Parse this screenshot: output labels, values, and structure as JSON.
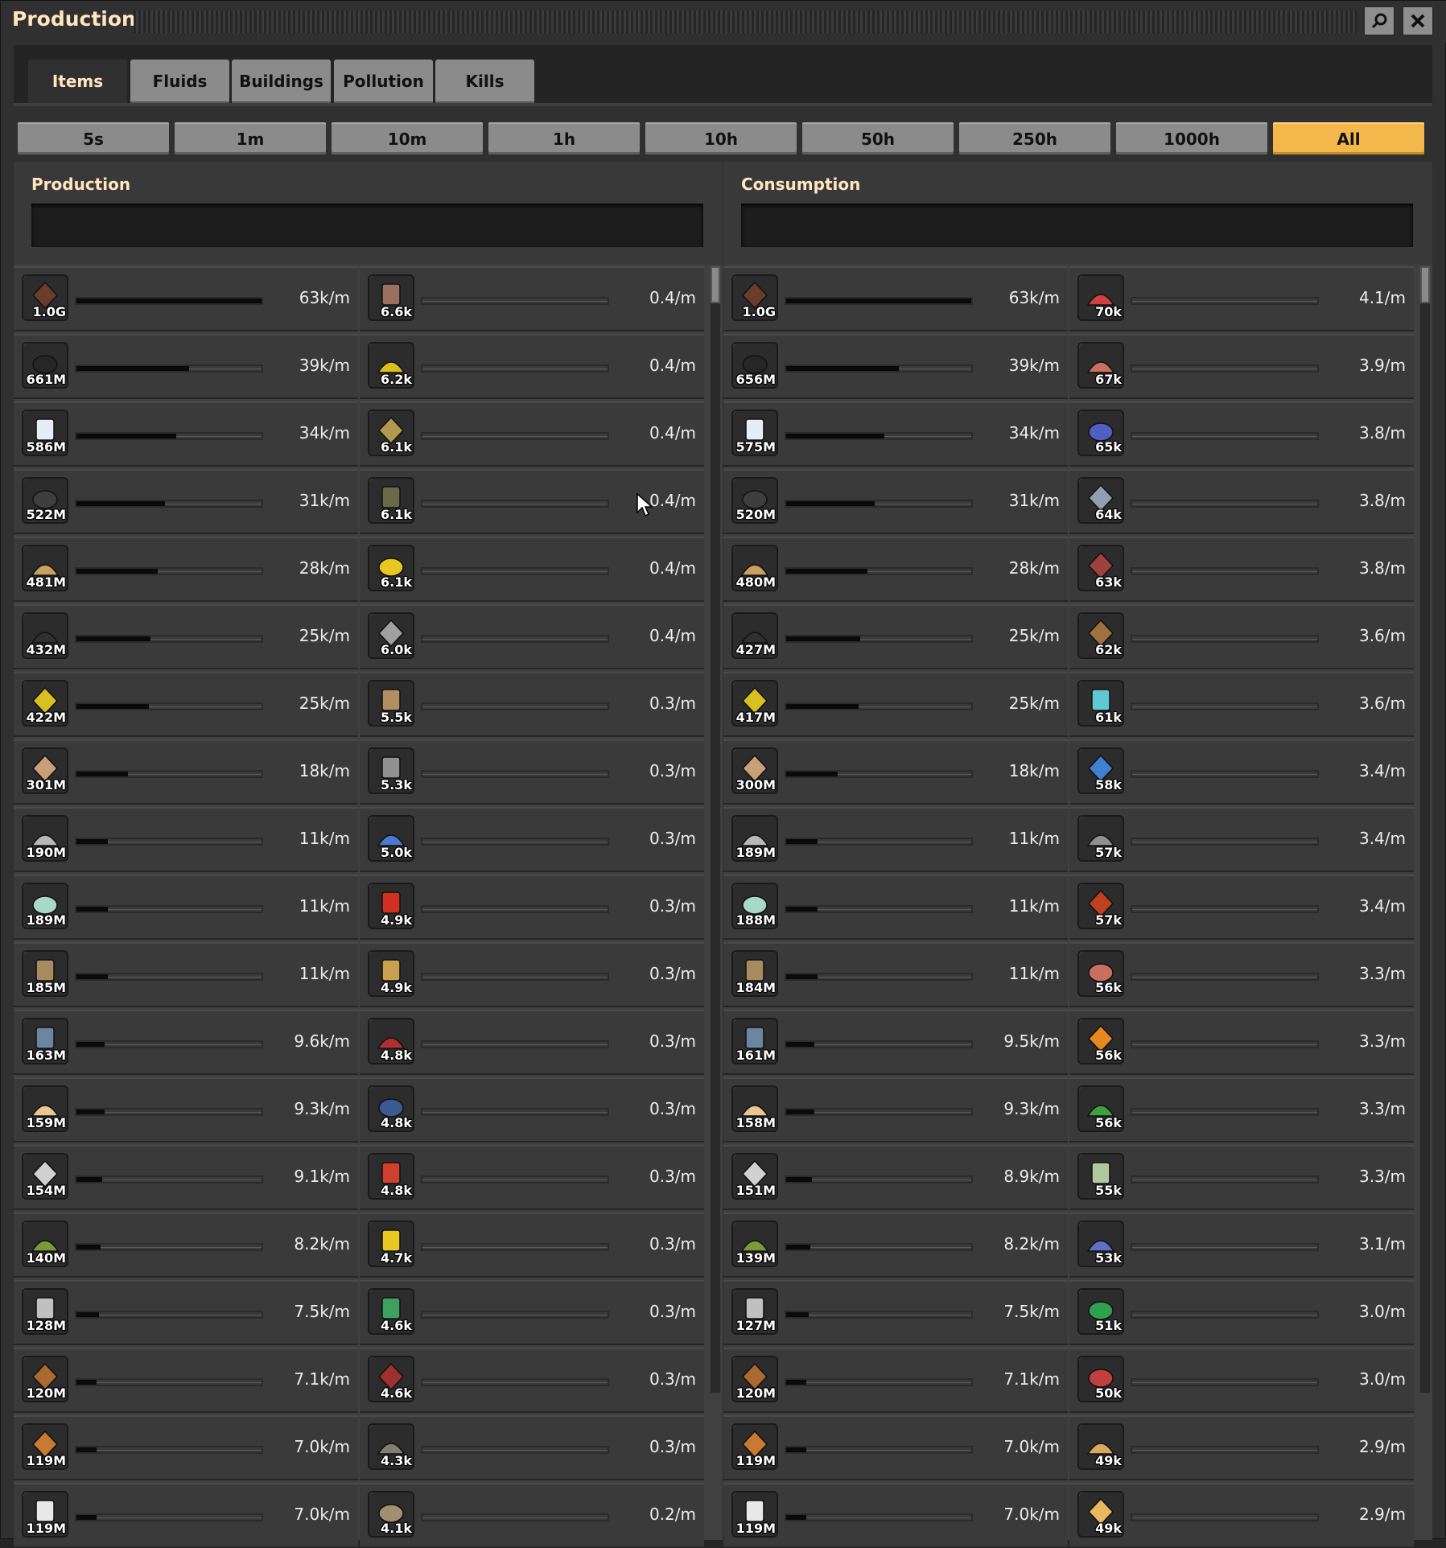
{
  "window": {
    "title": "Production",
    "search_icon": "search-icon",
    "close_icon": "close-icon"
  },
  "tabs": [
    "Items",
    "Fluids",
    "Buildings",
    "Pollution",
    "Kills"
  ],
  "active_tab": "Items",
  "time_ranges": [
    "5s",
    "1m",
    "10m",
    "1h",
    "10h",
    "50h",
    "250h",
    "1000h",
    "All"
  ],
  "active_time_range": "All",
  "production": {
    "title": "Production",
    "columns": [
      [
        {
          "icon": "stone-brick-icon",
          "count": "1.0G",
          "rate": "63k/m",
          "level": 1.0,
          "color": "#6b3b2b"
        },
        {
          "icon": "coal-icon",
          "count": "661M",
          "rate": "39k/m",
          "level": 0.61,
          "color": "#262626"
        },
        {
          "icon": "water-barrel-icon",
          "count": "586M",
          "rate": "34k/m",
          "level": 0.54,
          "color": "#e6eef5"
        },
        {
          "icon": "iron-ore-icon",
          "count": "522M",
          "rate": "31k/m",
          "level": 0.48,
          "color": "#3e3e3e"
        },
        {
          "icon": "sand-icon",
          "count": "481M",
          "rate": "28k/m",
          "level": 0.44,
          "color": "#c9a060"
        },
        {
          "icon": "coal-ore-icon",
          "count": "432M",
          "rate": "25k/m",
          "level": 0.4,
          "color": "#2f2f2f"
        },
        {
          "icon": "sulfur-icon",
          "count": "422M",
          "rate": "25k/m",
          "level": 0.39,
          "color": "#d8c020"
        },
        {
          "icon": "gravel-icon",
          "count": "301M",
          "rate": "18k/m",
          "level": 0.28,
          "color": "#c8a078"
        },
        {
          "icon": "plate-icon",
          "count": "190M",
          "rate": "11k/m",
          "level": 0.17,
          "color": "#b8b8b8"
        },
        {
          "icon": "quartz-icon",
          "count": "189M",
          "rate": "11k/m",
          "level": 0.17,
          "color": "#a8d8c8"
        },
        {
          "icon": "copper-ore-icon",
          "count": "185M",
          "rate": "11k/m",
          "level": 0.17,
          "color": "#a88a60"
        },
        {
          "icon": "cobalt-ore-icon",
          "count": "163M",
          "rate": "9.6k/m",
          "level": 0.15,
          "color": "#6c86a0"
        },
        {
          "icon": "tin-plate-icon",
          "count": "159M",
          "rate": "9.3k/m",
          "level": 0.15,
          "color": "#e8c890"
        },
        {
          "icon": "stone-icon",
          "count": "154M",
          "rate": "9.1k/m",
          "level": 0.14,
          "color": "#d0d0d0"
        },
        {
          "icon": "moss-icon",
          "count": "140M",
          "rate": "8.2k/m",
          "level": 0.13,
          "color": "#7a9a3a"
        },
        {
          "icon": "steel-plate-icon",
          "count": "128M",
          "rate": "7.5k/m",
          "level": 0.12,
          "color": "#c0c0c0"
        },
        {
          "icon": "wood-icon",
          "count": "120M",
          "rate": "7.1k/m",
          "level": 0.11,
          "color": "#a86a30"
        },
        {
          "icon": "copper-cable-icon",
          "count": "119M",
          "rate": "7.0k/m",
          "level": 0.11,
          "color": "#c87a30"
        },
        {
          "icon": "salt-icon",
          "count": "119M",
          "rate": "7.0k/m",
          "level": 0.11,
          "color": "#e8e8e8"
        }
      ],
      [
        {
          "icon": "rocket-part-icon",
          "count": "6.6k",
          "rate": "0.4/m",
          "level": 0,
          "color": "#9a7060"
        },
        {
          "icon": "uranium-cell-icon",
          "count": "6.2k",
          "rate": "0.4/m",
          "level": 0,
          "color": "#d8c020"
        },
        {
          "icon": "machine-icon",
          "count": "6.1k",
          "rate": "0.4/m",
          "level": 0,
          "color": "#b09a50"
        },
        {
          "icon": "barrel-icon",
          "count": "6.1k",
          "rate": "0.4/m",
          "level": 0,
          "color": "#6a6a4a"
        },
        {
          "icon": "radiation-icon",
          "count": "6.1k",
          "rate": "0.4/m",
          "level": 0,
          "color": "#e8c820"
        },
        {
          "icon": "ingot-icon",
          "count": "6.0k",
          "rate": "0.4/m",
          "level": 0,
          "color": "#a0a0a0"
        },
        {
          "icon": "shell-icon",
          "count": "5.5k",
          "rate": "0.3/m",
          "level": 0,
          "color": "#b09060"
        },
        {
          "icon": "blade-icon",
          "count": "5.3k",
          "rate": "0.3/m",
          "level": 0,
          "color": "#909090"
        },
        {
          "icon": "crystal-icon",
          "count": "5.0k",
          "rate": "0.3/m",
          "level": 0,
          "color": "#4a7ad0"
        },
        {
          "icon": "drops-icon",
          "count": "4.9k",
          "rate": "0.3/m",
          "level": 0,
          "color": "#d03020"
        },
        {
          "icon": "leaf-icon",
          "count": "4.9k",
          "rate": "0.3/m",
          "level": 0,
          "color": "#c8a050"
        },
        {
          "icon": "module-icon",
          "count": "4.8k",
          "rate": "0.3/m",
          "level": 0,
          "color": "#b03030"
        },
        {
          "icon": "orb-icon",
          "count": "4.8k",
          "rate": "0.3/m",
          "level": 0,
          "color": "#3a5a90"
        },
        {
          "icon": "rocket-icon",
          "count": "4.8k",
          "rate": "0.3/m",
          "level": 0,
          "color": "#d04030"
        },
        {
          "icon": "arm-icon",
          "count": "4.7k",
          "rate": "0.3/m",
          "level": 0,
          "color": "#e8c820"
        },
        {
          "icon": "tube-icon",
          "count": "4.6k",
          "rate": "0.3/m",
          "level": 0,
          "color": "#40a060"
        },
        {
          "icon": "red-gem-icon",
          "count": "4.6k",
          "rate": "0.3/m",
          "level": 0,
          "color": "#a03030"
        },
        {
          "icon": "tank-icon",
          "count": "4.3k",
          "rate": "0.3/m",
          "level": 0,
          "color": "#808070"
        },
        {
          "icon": "gear-icon",
          "count": "4.1k",
          "rate": "0.2/m",
          "level": 0,
          "color": "#a09070"
        }
      ]
    ]
  },
  "consumption": {
    "title": "Consumption",
    "columns": [
      [
        {
          "icon": "stone-brick-icon",
          "count": "1.0G",
          "rate": "63k/m",
          "level": 1.0,
          "color": "#6b3b2b"
        },
        {
          "icon": "coal-icon",
          "count": "656M",
          "rate": "39k/m",
          "level": 0.61,
          "color": "#262626"
        },
        {
          "icon": "water-barrel-icon",
          "count": "575M",
          "rate": "34k/m",
          "level": 0.53,
          "color": "#e6eef5"
        },
        {
          "icon": "iron-ore-icon",
          "count": "520M",
          "rate": "31k/m",
          "level": 0.48,
          "color": "#3e3e3e"
        },
        {
          "icon": "sand-icon",
          "count": "480M",
          "rate": "28k/m",
          "level": 0.44,
          "color": "#c9a060"
        },
        {
          "icon": "coal-ore-icon",
          "count": "427M",
          "rate": "25k/m",
          "level": 0.4,
          "color": "#2f2f2f"
        },
        {
          "icon": "sulfur-icon",
          "count": "417M",
          "rate": "25k/m",
          "level": 0.39,
          "color": "#d8c020"
        },
        {
          "icon": "gravel-icon",
          "count": "300M",
          "rate": "18k/m",
          "level": 0.28,
          "color": "#c8a078"
        },
        {
          "icon": "plate-icon",
          "count": "189M",
          "rate": "11k/m",
          "level": 0.17,
          "color": "#b8b8b8"
        },
        {
          "icon": "quartz-icon",
          "count": "188M",
          "rate": "11k/m",
          "level": 0.17,
          "color": "#a8d8c8"
        },
        {
          "icon": "copper-ore-icon",
          "count": "184M",
          "rate": "11k/m",
          "level": 0.17,
          "color": "#a88a60"
        },
        {
          "icon": "cobalt-ore-icon",
          "count": "161M",
          "rate": "9.5k/m",
          "level": 0.15,
          "color": "#6c86a0"
        },
        {
          "icon": "tin-plate-icon",
          "count": "158M",
          "rate": "9.3k/m",
          "level": 0.15,
          "color": "#e8c890"
        },
        {
          "icon": "stone-icon",
          "count": "151M",
          "rate": "8.9k/m",
          "level": 0.14,
          "color": "#d0d0d0"
        },
        {
          "icon": "moss-icon",
          "count": "139M",
          "rate": "8.2k/m",
          "level": 0.13,
          "color": "#7a9a3a"
        },
        {
          "icon": "steel-plate-icon",
          "count": "127M",
          "rate": "7.5k/m",
          "level": 0.12,
          "color": "#c0c0c0"
        },
        {
          "icon": "wood-icon",
          "count": "120M",
          "rate": "7.1k/m",
          "level": 0.11,
          "color": "#a86a30"
        },
        {
          "icon": "copper-cable-icon",
          "count": "119M",
          "rate": "7.0k/m",
          "level": 0.11,
          "color": "#c87a30"
        },
        {
          "icon": "salt-icon",
          "count": "119M",
          "rate": "7.0k/m",
          "level": 0.11,
          "color": "#e8e8e8"
        }
      ],
      [
        {
          "icon": "red-wand-icon",
          "count": "70k",
          "rate": "4.1/m",
          "level": 0,
          "color": "#d04040"
        },
        {
          "icon": "brick-pile-icon",
          "count": "67k",
          "rate": "3.9/m",
          "level": 0,
          "color": "#c87060"
        },
        {
          "icon": "feather-icon",
          "count": "65k",
          "rate": "3.8/m",
          "level": 0,
          "color": "#5060c0"
        },
        {
          "icon": "urchin-icon",
          "count": "64k",
          "rate": "3.8/m",
          "level": 0,
          "color": "#90a0b0"
        },
        {
          "icon": "canister-icon",
          "count": "63k",
          "rate": "3.8/m",
          "level": 0,
          "color": "#a04040"
        },
        {
          "icon": "rod-icon",
          "count": "62k",
          "rate": "3.6/m",
          "level": 0,
          "color": "#a07040"
        },
        {
          "icon": "ice-crystal-icon",
          "count": "61k",
          "rate": "3.6/m",
          "level": 0,
          "color": "#60c8d0"
        },
        {
          "icon": "syringe-icon",
          "count": "58k",
          "rate": "3.4/m",
          "level": 0,
          "color": "#4080d0"
        },
        {
          "icon": "bucket-icon",
          "count": "57k",
          "rate": "3.4/m",
          "level": 0,
          "color": "#909090"
        },
        {
          "icon": "beetle-icon",
          "count": "57k",
          "rate": "3.4/m",
          "level": 0,
          "color": "#c04020"
        },
        {
          "icon": "meat-icon",
          "count": "56k",
          "rate": "3.3/m",
          "level": 0,
          "color": "#c87060"
        },
        {
          "icon": "jar-icon",
          "count": "56k",
          "rate": "3.3/m",
          "level": 0,
          "color": "#e88820"
        },
        {
          "icon": "green-leaf-icon",
          "count": "56k",
          "rate": "3.3/m",
          "level": 0,
          "color": "#40a040"
        },
        {
          "icon": "paper-icon",
          "count": "55k",
          "rate": "3.3/m",
          "level": 0,
          "color": "#b0c8a0"
        },
        {
          "icon": "fish-icon",
          "count": "53k",
          "rate": "3.1/m",
          "level": 0,
          "color": "#6070c0"
        },
        {
          "icon": "green-jar-icon",
          "count": "51k",
          "rate": "3.0/m",
          "level": 0,
          "color": "#30a050"
        },
        {
          "icon": "crate-icon",
          "count": "50k",
          "rate": "3.0/m",
          "level": 0,
          "color": "#c04040"
        },
        {
          "icon": "bread-icon",
          "count": "49k",
          "rate": "2.9/m",
          "level": 0,
          "color": "#d8a860"
        },
        {
          "icon": "box-icon",
          "count": "49k",
          "rate": "2.9/m",
          "level": 0,
          "color": "#e8b860"
        }
      ]
    ]
  }
}
